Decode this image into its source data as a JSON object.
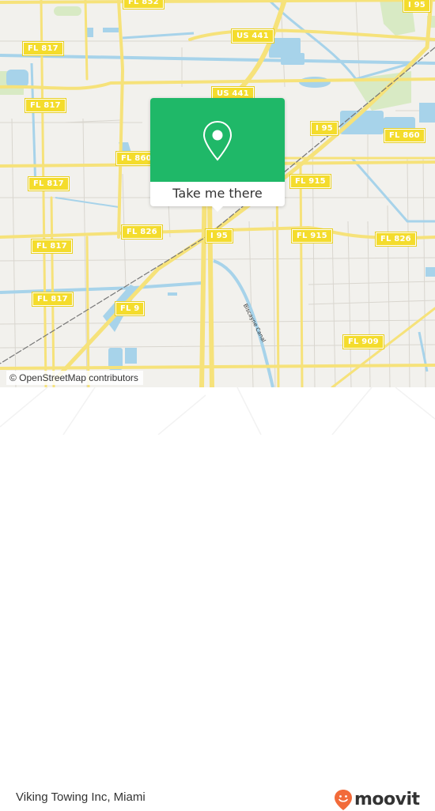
{
  "map": {
    "road_labels": [
      {
        "id": "fl852-top",
        "text": "FL 852"
      },
      {
        "id": "i95-top",
        "text": "I 95"
      },
      {
        "id": "fl817-a",
        "text": "FL 817"
      },
      {
        "id": "us441-a",
        "text": "US 441"
      },
      {
        "id": "fl817-b",
        "text": "FL 817"
      },
      {
        "id": "us441-b",
        "text": "US 441"
      },
      {
        "id": "i95-mid",
        "text": "I 95"
      },
      {
        "id": "fl860-right",
        "text": "FL 860"
      },
      {
        "id": "fl860-left",
        "text": "FL 860"
      },
      {
        "id": "fl817-c",
        "text": "FL 817"
      },
      {
        "id": "fl915-a",
        "text": "FL 915"
      },
      {
        "id": "fl826-left",
        "text": "FL 826"
      },
      {
        "id": "i95-center",
        "text": "I 95"
      },
      {
        "id": "fl915-b",
        "text": "FL 915"
      },
      {
        "id": "fl826-right",
        "text": "FL 826"
      },
      {
        "id": "fl817-d",
        "text": "FL 817"
      },
      {
        "id": "fl817-e",
        "text": "FL 817"
      },
      {
        "id": "fl9",
        "text": "FL 9"
      },
      {
        "id": "fl909",
        "text": "FL 909"
      }
    ],
    "canal_label": "Biscayne Canal",
    "attribution": "© OpenStreetMap contributors",
    "colors": {
      "road": "#f6e27a",
      "road_edge": "#e8cf4f",
      "water": "#a7d3ea",
      "park": "#d8eac4",
      "background": "#f2f1ed",
      "street": "#d6d3cc"
    }
  },
  "popup": {
    "icon": "map-pin-icon",
    "cta_label": "Take me there",
    "color": "#1fb868"
  },
  "footer": {
    "place_name": "Viking Towing Inc, Miami",
    "brand": {
      "name": "moovit",
      "icon": "moovit-smile-pin-icon",
      "color": "#f26b3a"
    }
  }
}
